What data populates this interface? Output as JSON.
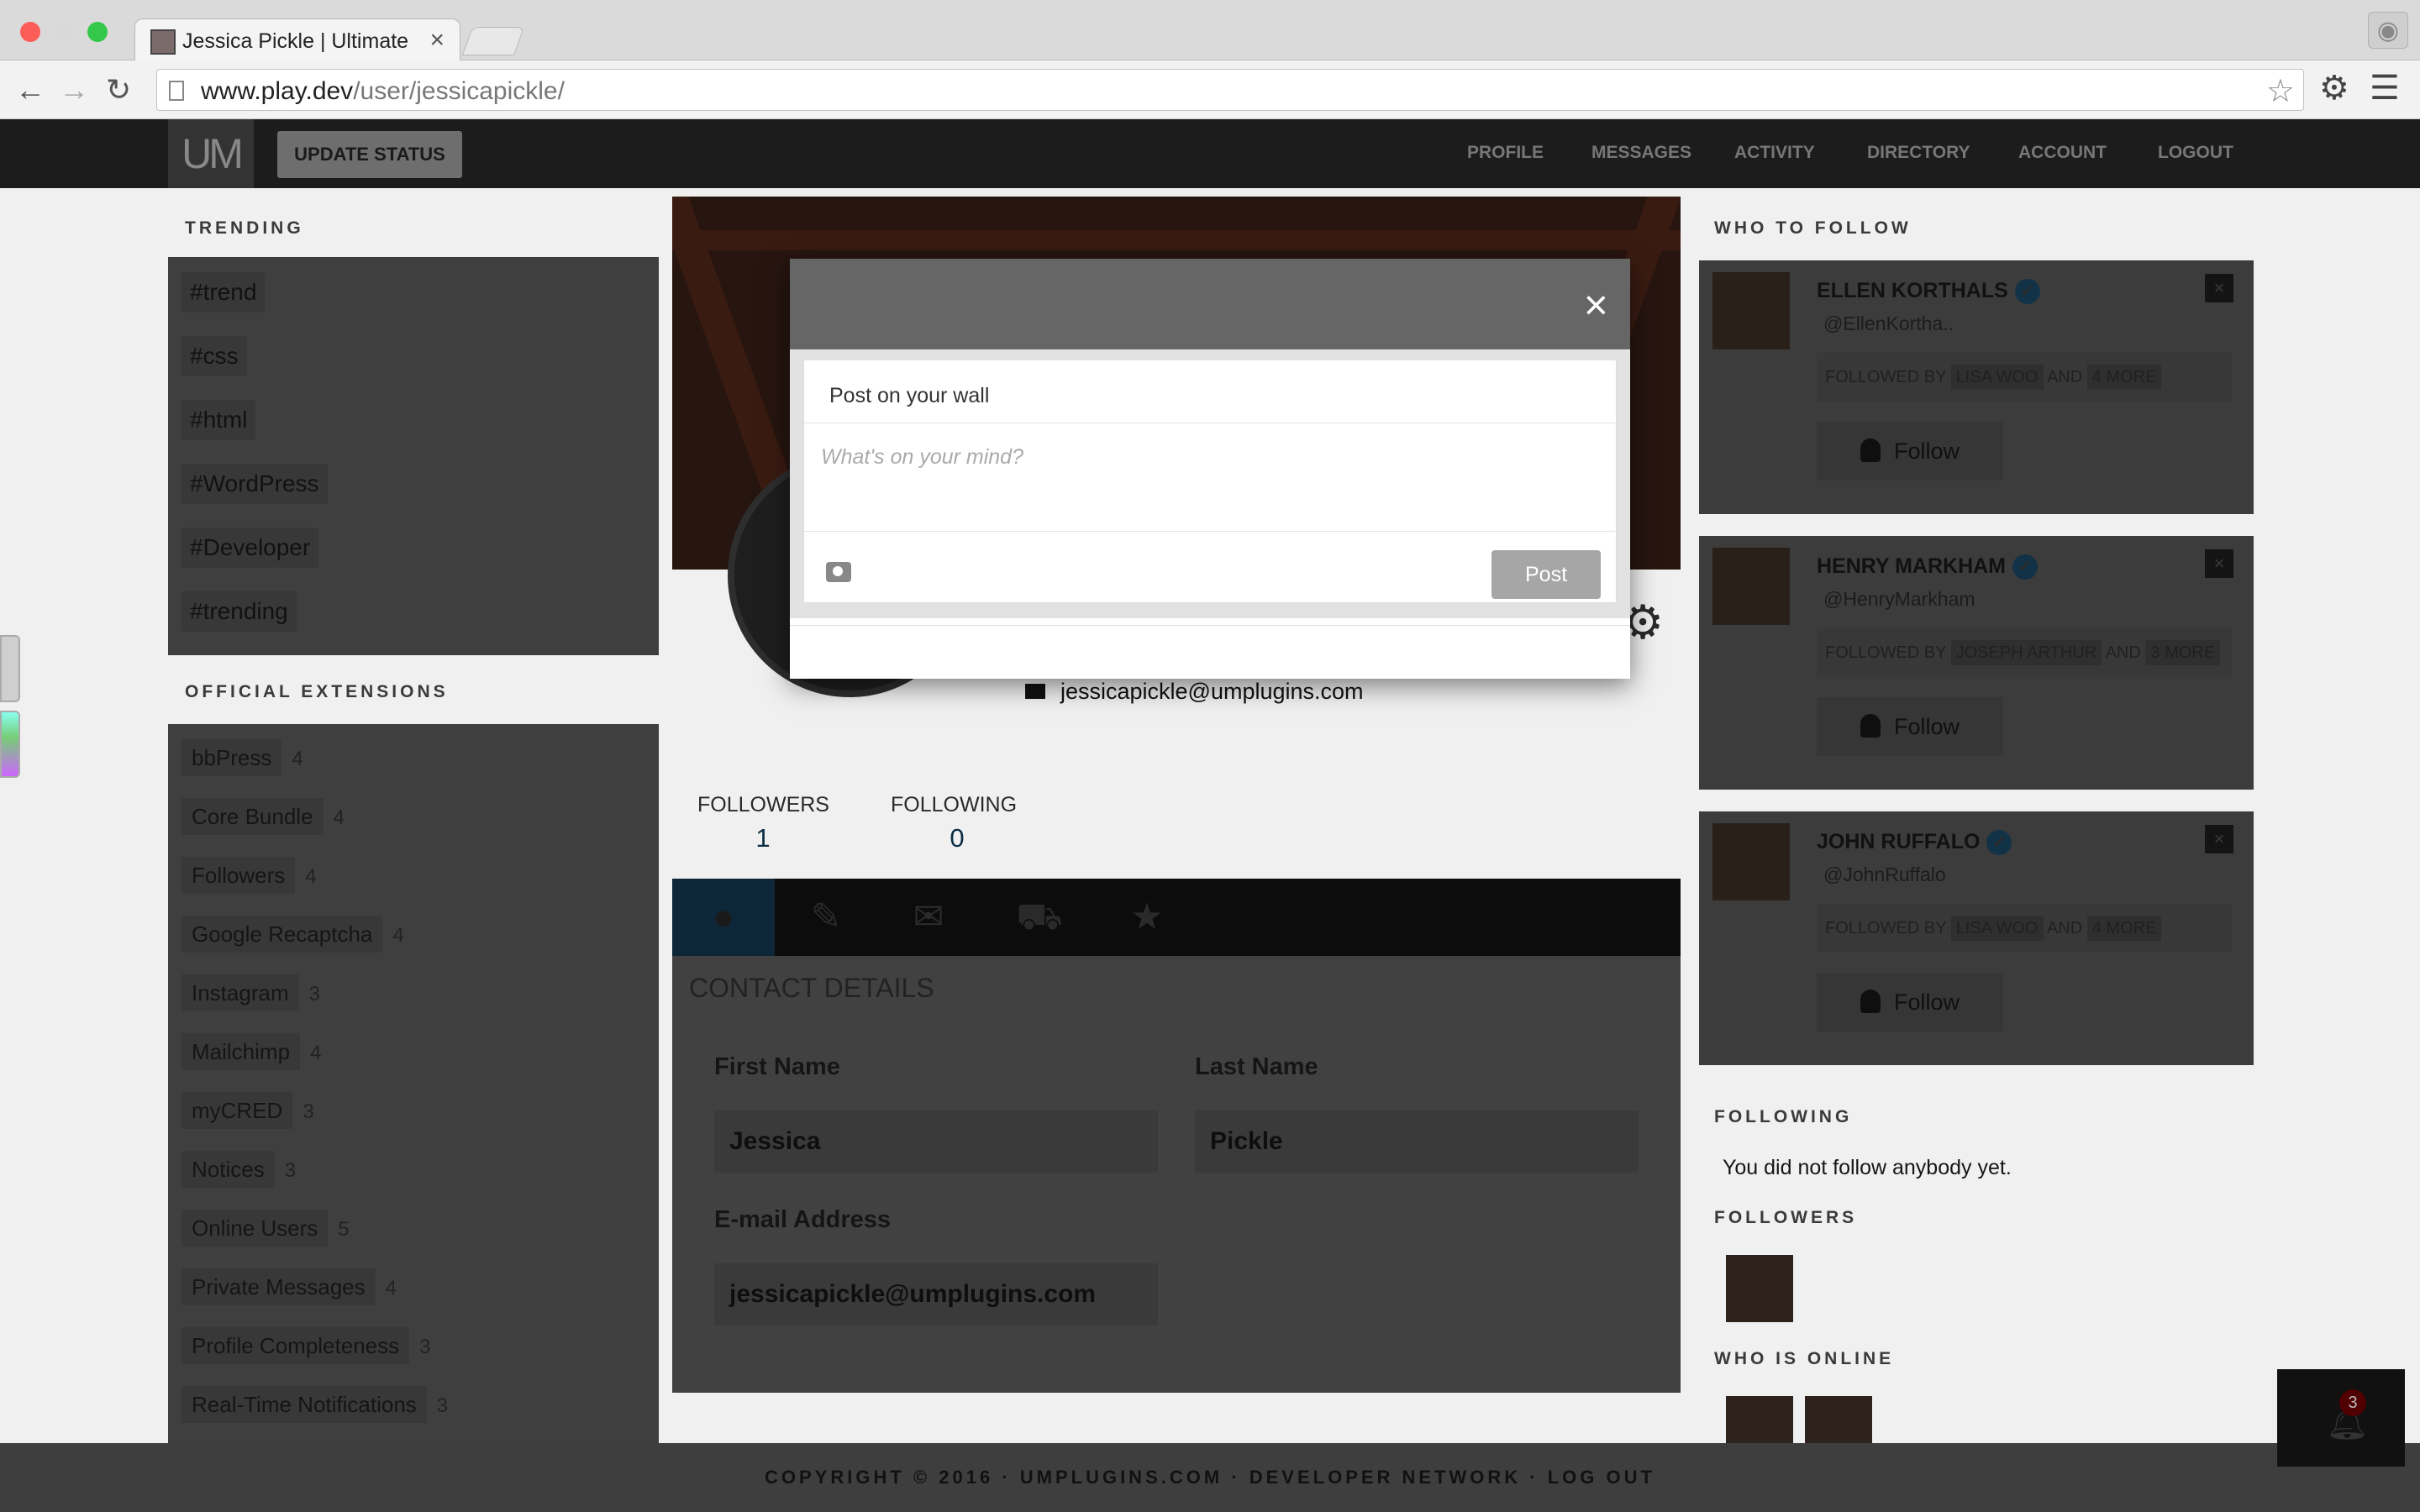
{
  "browser": {
    "tab_title": "Jessica Pickle | Ultimate Me",
    "url_domain": "www.play.dev",
    "url_path": "/user/jessicapickle/"
  },
  "header": {
    "logo": "UM",
    "update_status": "UPDATE STATUS",
    "nav": [
      "PROFILE",
      "MESSAGES",
      "ACTIVITY",
      "DIRECTORY",
      "ACCOUNT",
      "LOGOUT"
    ]
  },
  "trending": {
    "heading": "TRENDING",
    "tags": [
      "#trend",
      "#css",
      "#html",
      "#WordPress",
      "#Developer",
      "#trending"
    ]
  },
  "extensions": {
    "heading": "OFFICIAL EXTENSIONS",
    "items": [
      {
        "name": "bbPress",
        "count": "4"
      },
      {
        "name": "Core Bundle",
        "count": "4"
      },
      {
        "name": "Followers",
        "count": "4"
      },
      {
        "name": "Google Recaptcha",
        "count": "4"
      },
      {
        "name": "Instagram",
        "count": "3"
      },
      {
        "name": "Mailchimp",
        "count": "4"
      },
      {
        "name": "myCRED",
        "count": "3"
      },
      {
        "name": "Notices",
        "count": "3"
      },
      {
        "name": "Online Users",
        "count": "5"
      },
      {
        "name": "Private Messages",
        "count": "4"
      },
      {
        "name": "Profile Completeness",
        "count": "3"
      },
      {
        "name": "Real-Time Notifications",
        "count": "3"
      }
    ]
  },
  "profile": {
    "email": "jessicapickle@umplugins.com",
    "followers_label": "FOLLOWERS",
    "followers_value": "1",
    "following_label": "FOLLOWING",
    "following_value": "0",
    "tabs": [
      "user-icon",
      "edit-icon",
      "envelope-icon",
      "cart-icon",
      "star-icon"
    ]
  },
  "contact": {
    "title": "CONTACT DETAILS",
    "first_name_label": "First Name",
    "first_name": "Jessica",
    "last_name_label": "Last Name",
    "last_name": "Pickle",
    "email_label": "E-mail Address",
    "email": "jessicapickle@umplugins.com"
  },
  "who_to_follow": {
    "heading": "WHO TO FOLLOW",
    "cards": [
      {
        "name": "ELLEN KORTHALS",
        "handle": "@EllenKortha..",
        "followed_by": "FOLLOWED BY",
        "person": "LISA WOO",
        "and": "AND",
        "more": "4 MORE",
        "button": "Follow"
      },
      {
        "name": "HENRY MARKHAM",
        "handle": "@HenryMarkham",
        "followed_by": "FOLLOWED BY",
        "person": "JOSEPH ARTHUR",
        "and": "AND",
        "more": "3 MORE",
        "button": "Follow"
      },
      {
        "name": "JOHN RUFFALO",
        "handle": "@JohnRuffalo",
        "followed_by": "FOLLOWED BY",
        "person": "LISA WOO",
        "and": "AND",
        "more": "4 MORE",
        "button": "Follow"
      }
    ]
  },
  "following": {
    "heading": "FOLLOWING",
    "empty_text": "You did not follow anybody yet."
  },
  "followers": {
    "heading": "FOLLOWERS"
  },
  "who_is_online": {
    "heading": "WHO IS ONLINE"
  },
  "footer": {
    "text": "COPYRIGHT © 2016 · UMPLUGINS.COM · DEVELOPER NETWORK · LOG OUT"
  },
  "notifications": {
    "count": "3"
  },
  "modal": {
    "title": "Post on your wall",
    "placeholder": "What's on your mind?",
    "post_button": "Post",
    "close": "×"
  }
}
